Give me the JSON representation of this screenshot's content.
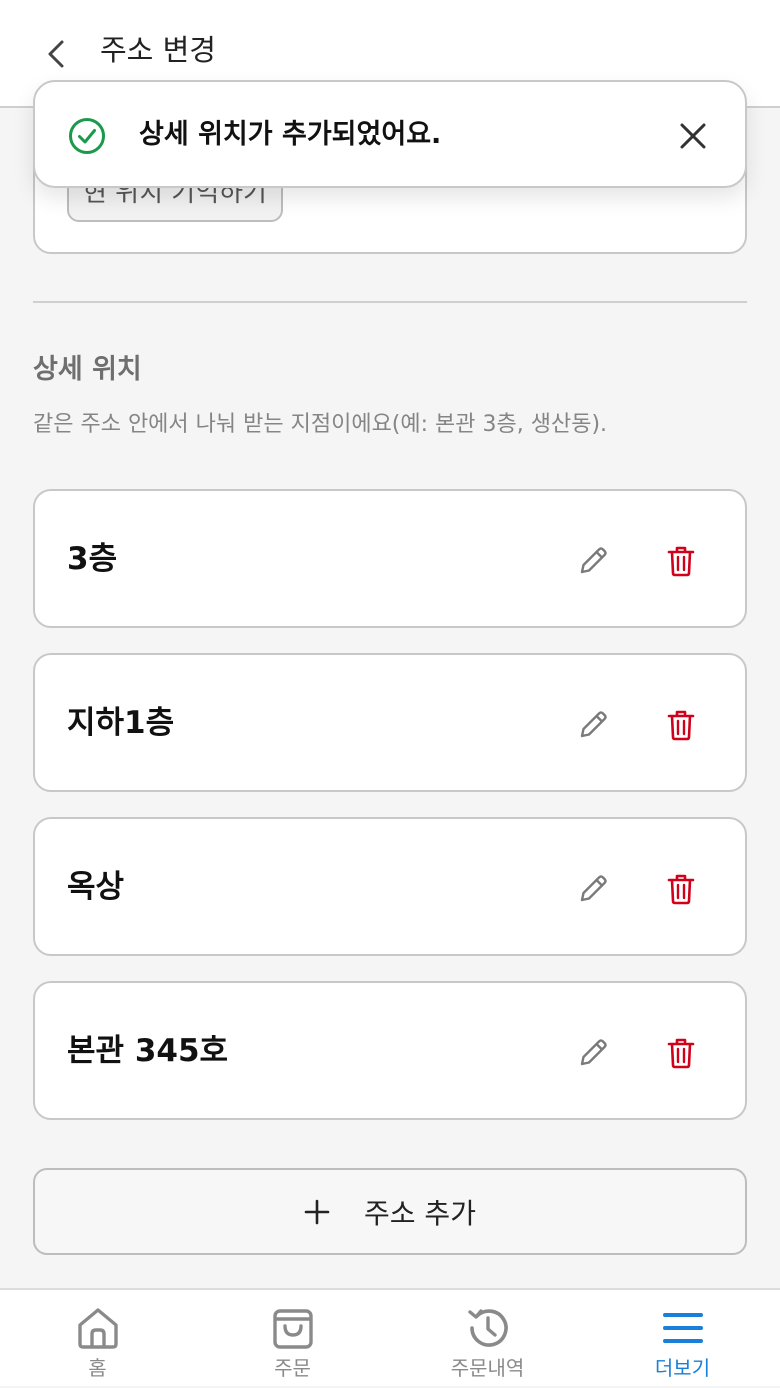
{
  "header": {
    "title": "주소 변경"
  },
  "top_card": {
    "button_label": "현 위치 기억하기"
  },
  "toast": {
    "message": "상세 위치가 추가되었어요.",
    "icon": "check-circle-icon",
    "close_icon": "close-icon",
    "accent": "#1a9a4a"
  },
  "section": {
    "title": "상세 위치",
    "description": "같은 주소 안에서 나눠 받는 지점이에요(예: 본관 3층, 생산동)."
  },
  "locations": [
    {
      "name": "3층"
    },
    {
      "name": "지하1층"
    },
    {
      "name": "옥상"
    },
    {
      "name": "본관 345호"
    }
  ],
  "add_button": {
    "label": "주소 추가",
    "icon": "plus-icon"
  },
  "tabbar": {
    "tabs": [
      {
        "label": "홈",
        "icon": "home-icon",
        "active": false
      },
      {
        "label": "주문",
        "icon": "shopping-bag-icon",
        "active": false
      },
      {
        "label": "주문내역",
        "icon": "history-icon",
        "active": false
      },
      {
        "label": "더보기",
        "icon": "menu-icon",
        "active": true
      }
    ],
    "active_color": "#1a7fd8"
  },
  "colors": {
    "delete": "#d0021b",
    "edit": "#7a7a7a"
  }
}
